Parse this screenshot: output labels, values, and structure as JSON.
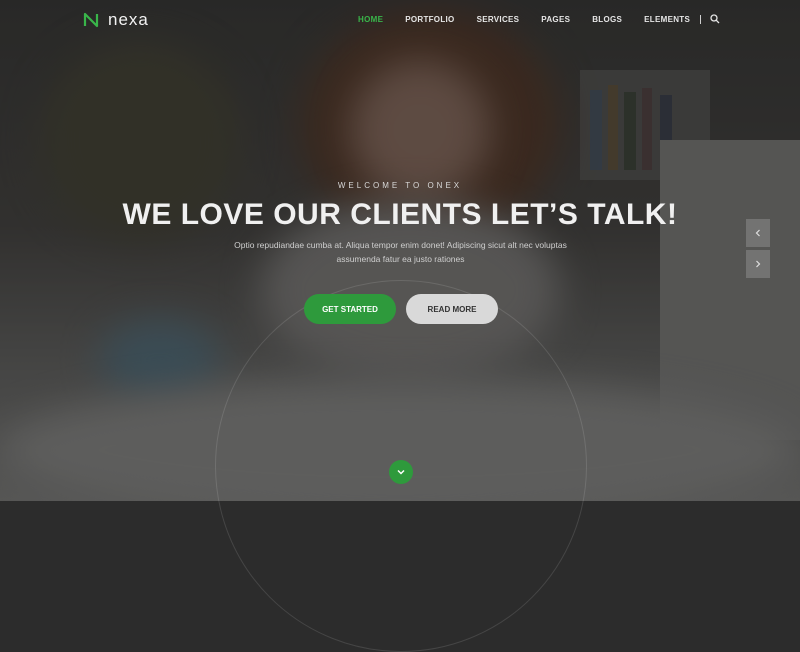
{
  "brand": {
    "name": "nexa",
    "accent": "#39b54a"
  },
  "nav": {
    "items": [
      {
        "label": "HOME",
        "active": true
      },
      {
        "label": "PORTFOLIO",
        "active": false
      },
      {
        "label": "SERVICES",
        "active": false
      },
      {
        "label": "PAGES",
        "active": false
      },
      {
        "label": "BLOGS",
        "active": false
      },
      {
        "label": "ELEMENTS",
        "active": false
      }
    ],
    "search_icon": "search-icon"
  },
  "hero": {
    "tagline": "WELCOME TO ONEX",
    "headline": "WE LOVE OUR CLIENTS LET’S TALK!",
    "description": "Optio repudiandae cumba at. Aliqua tempor enim donet! Adipiscing sicut alt nec voluptas assumenda fatur ea justo rationes",
    "primary_button": "GET STARTED",
    "secondary_button": "READ MORE",
    "prev_icon": "chevron-left-icon",
    "next_icon": "chevron-right-icon",
    "scroll_icon": "chevron-down-icon"
  }
}
